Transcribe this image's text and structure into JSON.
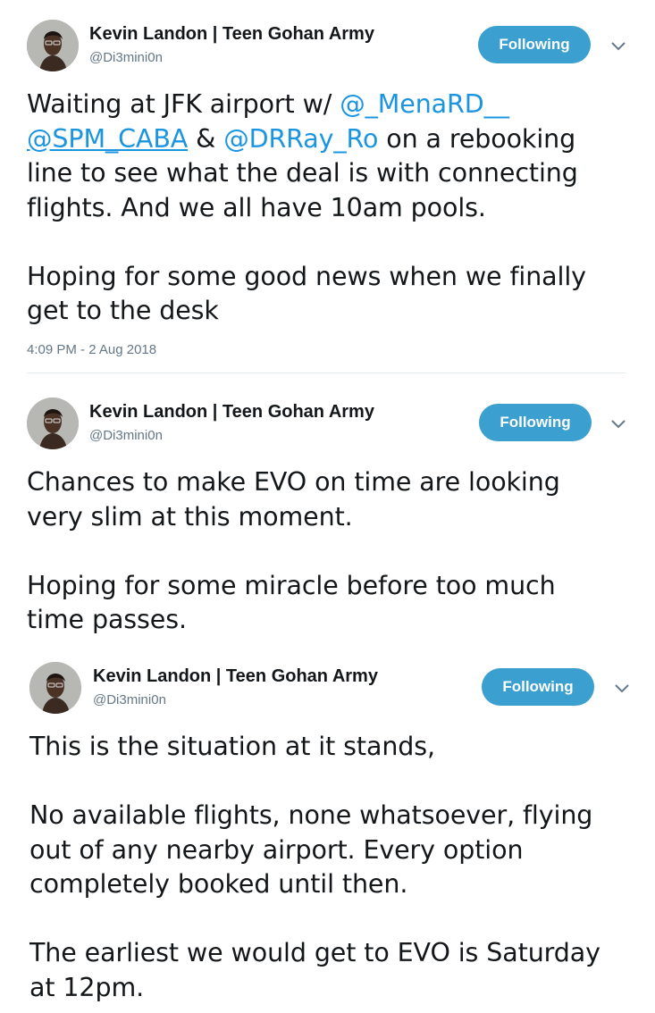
{
  "tweets": [
    {
      "author_name": "Kevin Landon | Teen Gohan Army",
      "author_handle": "@Di3mini0n",
      "follow_label": "Following",
      "text": {
        "l1a": "Waiting at JFK airport w/ ",
        "l1m1": "@_MenaRD__",
        "l2m1": "@SPM_CABA",
        "l2b": " & ",
        "l2m2": "@DRRay_Ro",
        "l2c": " on a rebooking",
        "l3": "line to see what the deal is with connecting",
        "l4": "flights. And we all have 10am pools.",
        "l6": "Hoping for some good news when we finally",
        "l7": "get to the desk"
      },
      "timestamp": "4:09 PM - 2 Aug 2018"
    },
    {
      "author_name": "Kevin Landon | Teen Gohan Army",
      "author_handle": "@Di3mini0n",
      "follow_label": "Following",
      "text": {
        "l1": "Chances to make EVO on time are looking",
        "l2": "very slim at this moment.",
        "l4": "Hoping for some miracle before too much",
        "l5": "time passes."
      }
    },
    {
      "author_name": "Kevin Landon | Teen Gohan Army",
      "author_handle": "@Di3mini0n",
      "follow_label": "Following",
      "text": {
        "l1": "This is the situation at it stands,",
        "l3": "No available flights, none whatsoever, flying",
        "l4": "out of any nearby airport. Every option",
        "l5": "completely booked until then.",
        "l7": "The earliest we would get to EVO is Saturday",
        "l8": "at 12pm."
      }
    }
  ],
  "icons": {
    "avatar": "avatar-photo",
    "menu": "chevron-down-icon"
  },
  "colors": {
    "link": "#1b95e0",
    "button": "#3b9fd0",
    "secondary_text": "#657786",
    "divider": "#e6ecf0"
  }
}
